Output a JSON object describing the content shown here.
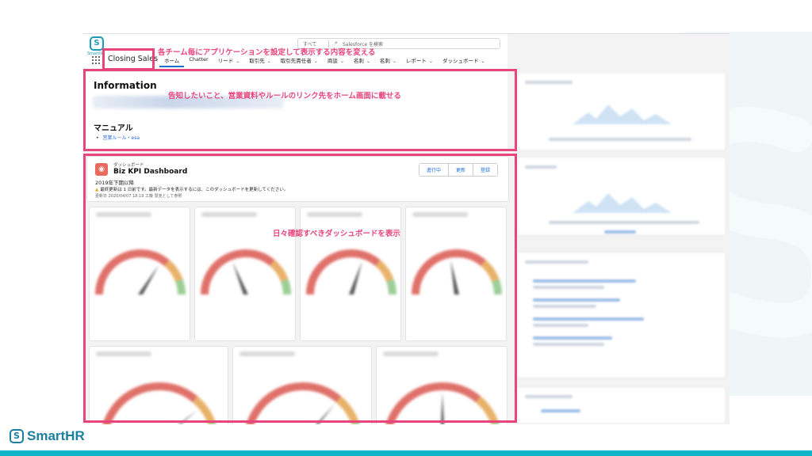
{
  "header": {
    "logo_text": "Smartllo",
    "search_scope": "すべて",
    "search_placeholder": "Salesforce を検索",
    "app_name": "Closing Sales",
    "nav": [
      {
        "label": "ホーム",
        "chevron": false,
        "active": true
      },
      {
        "label": "Chatter",
        "chevron": false
      },
      {
        "label": "リード",
        "chevron": true
      },
      {
        "label": "取引先",
        "chevron": true
      },
      {
        "label": "取引先責任者",
        "chevron": true
      },
      {
        "label": "商談",
        "chevron": true
      },
      {
        "label": "名刺",
        "chevron": true
      },
      {
        "label": "名刺",
        "chevron": true
      },
      {
        "label": "レポート",
        "chevron": true
      },
      {
        "label": "ダッシュボード",
        "chevron": true
      }
    ]
  },
  "info": {
    "title": "Information",
    "manual_title": "マニュアル",
    "manual_link": "営業ルール・esa"
  },
  "dashboard": {
    "kicker": "ダッシュボード",
    "name": "Biz KPI Dashboard",
    "period": "2019年下期以降",
    "warning": "最終更新は 1 日前です。最新データを表示するには、このダッシュボードを更新してください。",
    "updated": "更新日 2020/04/07 18:19 工藤 慧克として参照",
    "buttons": [
      "進行中",
      "更新",
      "登録"
    ]
  },
  "annotations": {
    "nav_note": "各チーム毎にアプリケーションを設定して表示する内容を変える",
    "info_note": "告知したいこと、営業資料やルールのリンク先をホーム画面に載せる",
    "dash_note": "日々確認すべきダッシュボードを表示"
  },
  "footer": {
    "brand": "SmartHR"
  },
  "colors": {
    "annotation_pink": "#e8457d",
    "brand_teal": "#1a7fa0",
    "footer_bar": "#0fb4c9"
  }
}
